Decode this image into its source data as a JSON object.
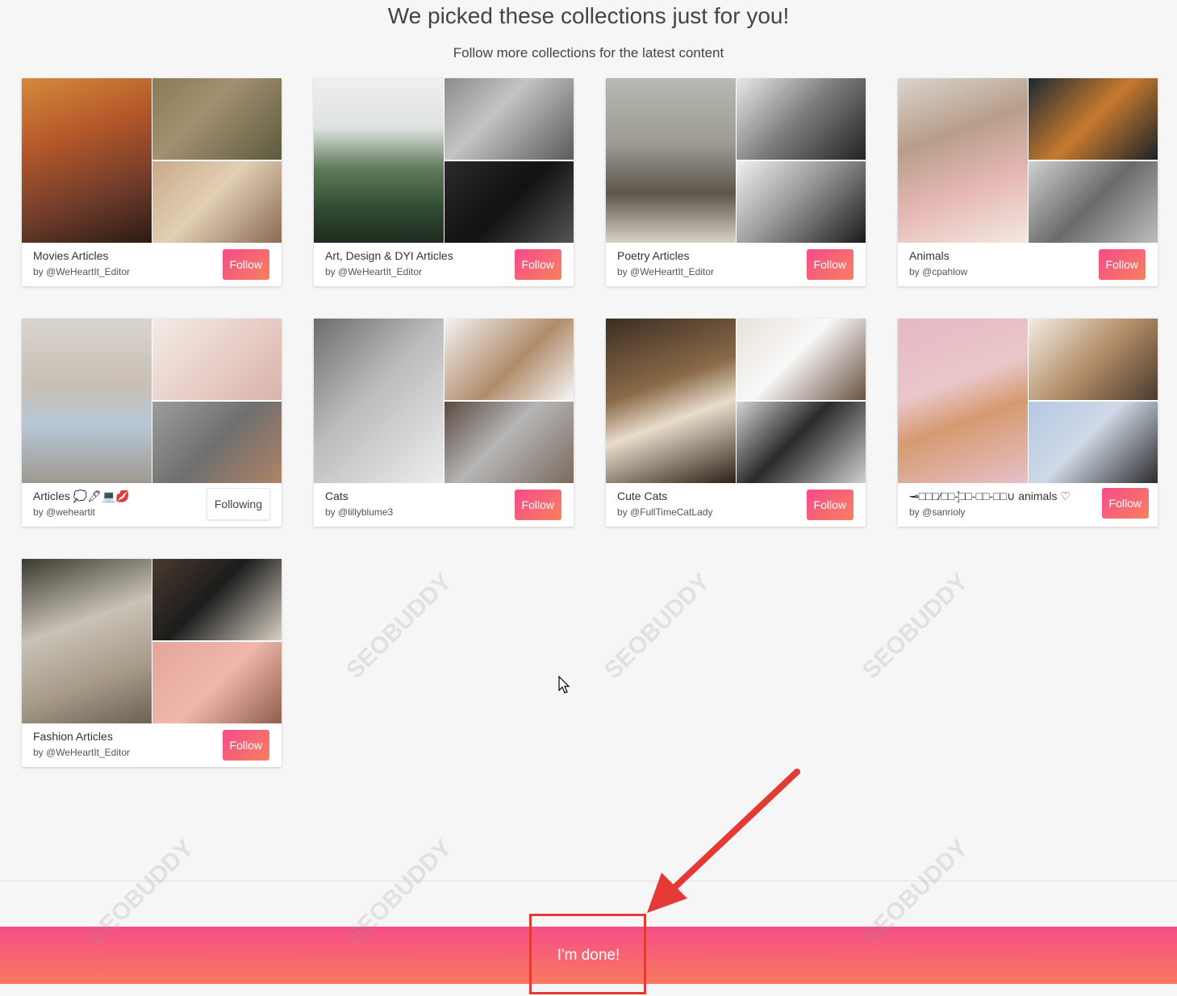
{
  "page": {
    "heading": "We picked these collections just for you!",
    "subheading": "Follow more collections for the latest content",
    "done_label": "I'm done!",
    "accent_gradient": [
      "#f54b8a",
      "#f9805e"
    ],
    "annotation_color": "#e53935"
  },
  "watermark": "SEOBUDDY",
  "collections": [
    {
      "title": "Movies Articles",
      "author": "by @WeHeartIt_Editor",
      "button": "Follow",
      "following": false
    },
    {
      "title": "Art, Design & DYI Articles",
      "author": "by @WeHeartIt_Editor",
      "button": "Follow",
      "following": false
    },
    {
      "title": "Poetry Articles",
      "author": "by @WeHeartIt_Editor",
      "button": "Follow",
      "following": false
    },
    {
      "title": "Animals",
      "author": "by @cpahlow",
      "button": "Follow",
      "following": false
    },
    {
      "title": "Articles 💭🖊💻💋",
      "author": "by @weheartit",
      "button": "Following",
      "following": true
    },
    {
      "title": "Cats",
      "author": "by @lillyblume3",
      "button": "Follow",
      "following": false
    },
    {
      "title": "Cute Cats",
      "author": "by @FullTimeCatLady",
      "button": "Follow",
      "following": false
    },
    {
      "title": "⊸̶□□□⁄□□-̥̊□□-□□-□□∪ animals ♡",
      "author": "by @sanrioly",
      "button": "Follow",
      "following": false
    },
    {
      "title": "Fashion Articles",
      "author": "by @WeHeartIt_Editor",
      "button": "Follow",
      "following": false
    }
  ]
}
